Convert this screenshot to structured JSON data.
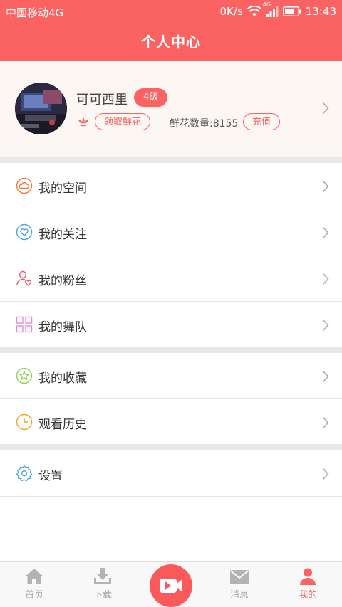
{
  "status_bar": {
    "carrier": "中国移动4G",
    "speed": "0K/s",
    "network": "4G",
    "time": "13:43"
  },
  "header": {
    "title": "个人中心"
  },
  "profile": {
    "username": "可可西里",
    "level": "4级",
    "get_flower_label": "领取鲜花",
    "flower_count_text": "鲜花数量:8155",
    "recharge_label": "充值"
  },
  "menu": {
    "group1": [
      {
        "label": "我的空间",
        "icon": "cloud-icon",
        "color": "#f0783c"
      },
      {
        "label": "我的关注",
        "icon": "heart-icon",
        "color": "#4aa3e0"
      },
      {
        "label": "我的粉丝",
        "icon": "fans-icon",
        "color": "#f05a7a"
      },
      {
        "label": "我的舞队",
        "icon": "grid-icon",
        "color": "#e58ae6"
      }
    ],
    "group2": [
      {
        "label": "我的收藏",
        "icon": "star-icon",
        "color": "#8fd14f"
      },
      {
        "label": "观看历史",
        "icon": "clock-icon",
        "color": "#f5a023"
      }
    ],
    "group3": [
      {
        "label": "设置",
        "icon": "gear-icon",
        "color": "#4aa3e0"
      }
    ]
  },
  "tabbar": {
    "items": [
      {
        "label": "首页",
        "icon": "home-icon"
      },
      {
        "label": "下载",
        "icon": "download-icon"
      },
      {
        "label": "",
        "icon": "video-record-icon"
      },
      {
        "label": "消息",
        "icon": "mail-icon"
      },
      {
        "label": "我的",
        "icon": "user-icon"
      }
    ],
    "active_color": "#fb6262",
    "inactive_color": "#a8a8a8"
  },
  "colors": {
    "primary": "#fb6262",
    "profile_bg": "#fdf7f3",
    "divider": "#e8e8e8"
  }
}
